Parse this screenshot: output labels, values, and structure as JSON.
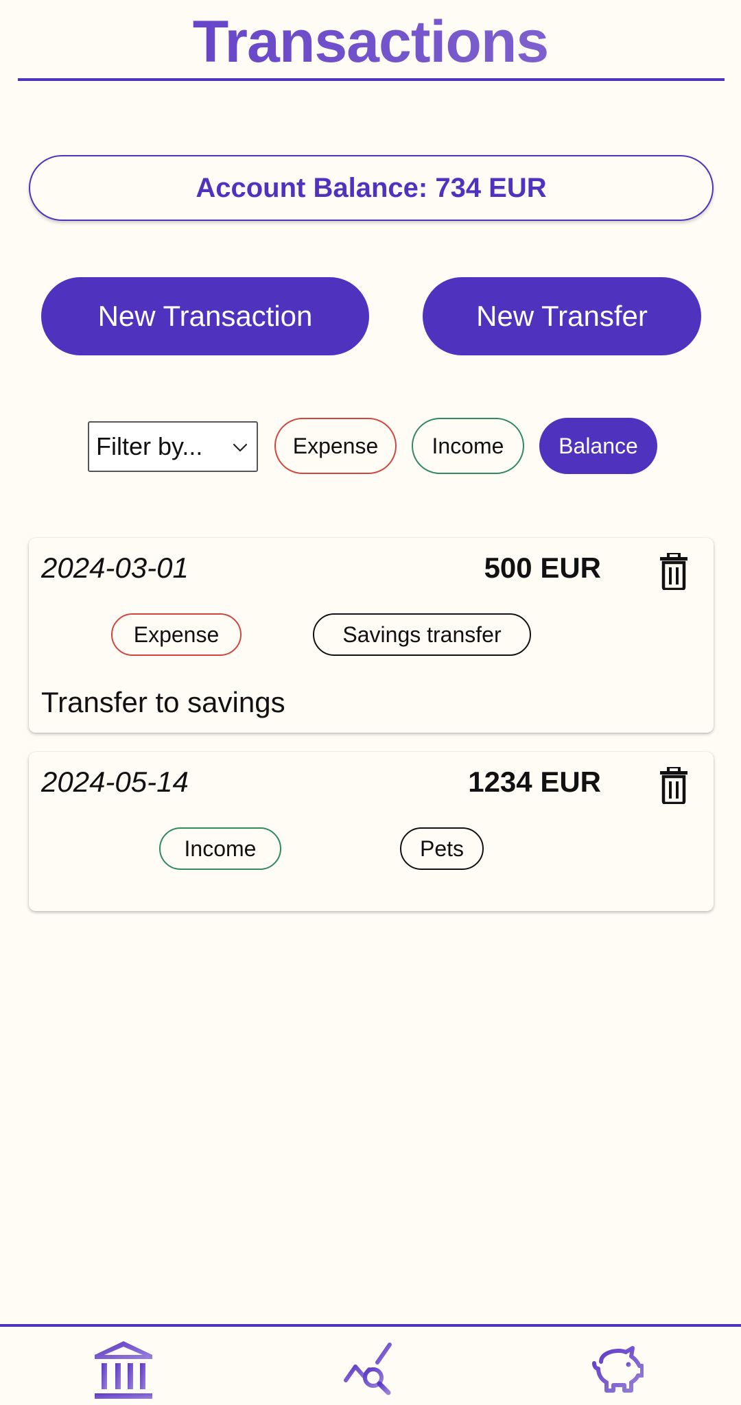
{
  "header": {
    "title": "Transactions"
  },
  "balance": {
    "label": "Account Balance: 734 EUR"
  },
  "actions": {
    "new_transaction": "New Transaction",
    "new_transfer": "New Transfer"
  },
  "filter": {
    "select_value": "Filter by...",
    "chips": {
      "expense": "Expense",
      "income": "Income",
      "balance": "Balance"
    },
    "active": "Balance"
  },
  "transactions": [
    {
      "date": "2024-03-01",
      "amount": "500 EUR",
      "type": "Expense",
      "category": "Savings transfer",
      "description": "Transfer to savings"
    },
    {
      "date": "2024-05-14",
      "amount": "1234 EUR",
      "type": "Income",
      "category": "Pets",
      "description": ""
    }
  ],
  "nav": {
    "items": [
      {
        "icon": "bank-icon",
        "active": true
      },
      {
        "icon": "analytics-search-icon",
        "active": false
      },
      {
        "icon": "piggy-bank-icon",
        "active": false
      }
    ]
  },
  "colors": {
    "accent": "#4f33bf",
    "background": "#fffbf5",
    "expense": "#d0453e",
    "income": "#2f8a5c"
  }
}
